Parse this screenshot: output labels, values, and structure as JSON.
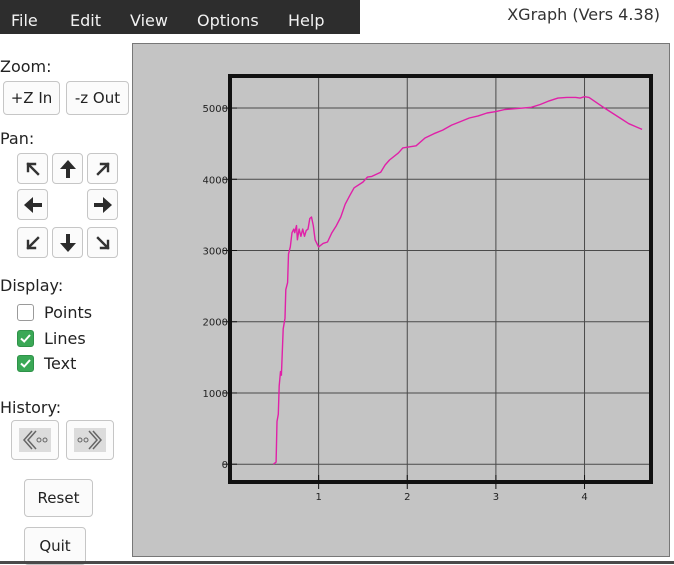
{
  "menu": {
    "file": "File",
    "edit": "Edit",
    "view": "View",
    "options": "Options",
    "help": "Help"
  },
  "app_title": "XGraph (Vers 4.38)",
  "zoom": {
    "label": "Zoom:",
    "zoom_in": "+Z In",
    "zoom_out": "-z Out"
  },
  "pan": {
    "label": "Pan:"
  },
  "display": {
    "label": "Display:",
    "points": {
      "label": "Points",
      "checked": false
    },
    "lines": {
      "label": "Lines",
      "checked": true
    },
    "text": {
      "label": "Text",
      "checked": true
    }
  },
  "history": {
    "label": "History:"
  },
  "reset_label": "Reset",
  "quit_label": "Quit",
  "colors": {
    "line": "#e020a8",
    "plot_bg": "#c4c4c4",
    "check_on": "#3aa856",
    "menubar": "#2d2d2d"
  },
  "chart_data": {
    "type": "line",
    "xlim": [
      0.0,
      4.75
    ],
    "ylim": [
      -250,
      5450
    ],
    "x_ticks": [
      "1",
      "2",
      "3",
      "4"
    ],
    "x_tick_values": [
      1,
      2,
      3,
      4
    ],
    "y_ticks": [
      "0",
      "1000",
      "2000",
      "3000",
      "4000",
      "5000"
    ],
    "y_tick_values": [
      0,
      1000,
      2000,
      3000,
      4000,
      5000
    ],
    "grid": true,
    "series": [
      {
        "color": "#e020a8",
        "points": [
          [
            0.49,
            0
          ],
          [
            0.52,
            30
          ],
          [
            0.53,
            600
          ],
          [
            0.545,
            700
          ],
          [
            0.555,
            1100
          ],
          [
            0.57,
            1300
          ],
          [
            0.58,
            1250
          ],
          [
            0.6,
            1900
          ],
          [
            0.62,
            2050
          ],
          [
            0.63,
            2450
          ],
          [
            0.65,
            2550
          ],
          [
            0.66,
            2950
          ],
          [
            0.68,
            3050
          ],
          [
            0.7,
            3250
          ],
          [
            0.72,
            3300
          ],
          [
            0.73,
            3250
          ],
          [
            0.75,
            3350
          ],
          [
            0.76,
            3150
          ],
          [
            0.78,
            3300
          ],
          [
            0.8,
            3200
          ],
          [
            0.82,
            3300
          ],
          [
            0.84,
            3200
          ],
          [
            0.86,
            3280
          ],
          [
            0.88,
            3300
          ],
          [
            0.9,
            3450
          ],
          [
            0.92,
            3470
          ],
          [
            0.94,
            3350
          ],
          [
            0.96,
            3150
          ],
          [
            1.0,
            3050
          ],
          [
            1.05,
            3100
          ],
          [
            1.1,
            3120
          ],
          [
            1.15,
            3250
          ],
          [
            1.2,
            3350
          ],
          [
            1.25,
            3470
          ],
          [
            1.3,
            3650
          ],
          [
            1.35,
            3770
          ],
          [
            1.4,
            3880
          ],
          [
            1.5,
            3960
          ],
          [
            1.55,
            4030
          ],
          [
            1.6,
            4040
          ],
          [
            1.7,
            4100
          ],
          [
            1.75,
            4200
          ],
          [
            1.8,
            4270
          ],
          [
            1.9,
            4370
          ],
          [
            1.95,
            4440
          ],
          [
            2.0,
            4450
          ],
          [
            2.1,
            4470
          ],
          [
            2.2,
            4580
          ],
          [
            2.3,
            4640
          ],
          [
            2.4,
            4690
          ],
          [
            2.5,
            4760
          ],
          [
            2.6,
            4810
          ],
          [
            2.7,
            4860
          ],
          [
            2.8,
            4890
          ],
          [
            2.9,
            4930
          ],
          [
            3.0,
            4950
          ],
          [
            3.1,
            4980
          ],
          [
            3.2,
            4990
          ],
          [
            3.3,
            5000
          ],
          [
            3.4,
            5010
          ],
          [
            3.5,
            5050
          ],
          [
            3.6,
            5100
          ],
          [
            3.7,
            5140
          ],
          [
            3.8,
            5150
          ],
          [
            3.9,
            5150
          ],
          [
            3.95,
            5140
          ],
          [
            4.0,
            5160
          ],
          [
            4.05,
            5150
          ],
          [
            4.2,
            5020
          ],
          [
            4.4,
            4860
          ],
          [
            4.5,
            4780
          ],
          [
            4.65,
            4700
          ]
        ]
      }
    ]
  }
}
